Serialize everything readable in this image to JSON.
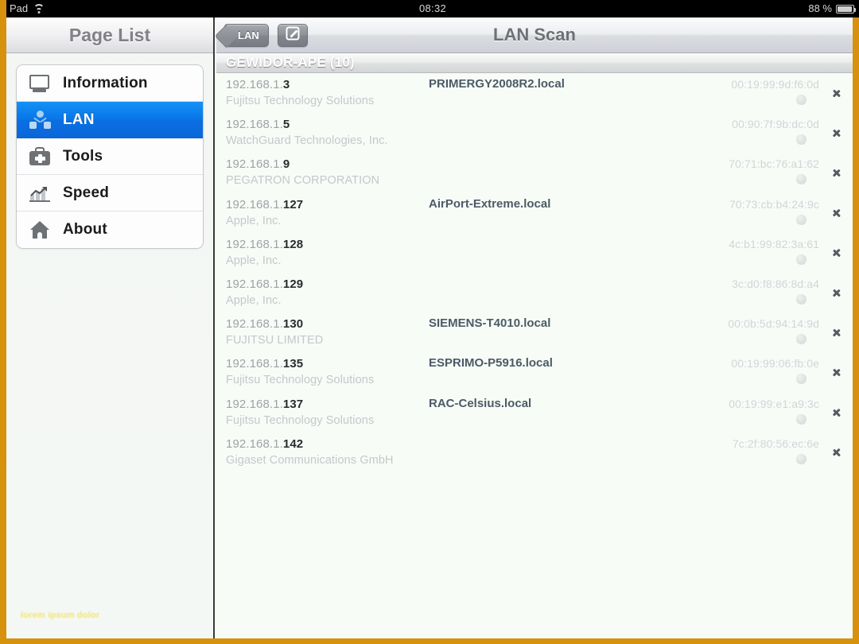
{
  "status_bar": {
    "carrier": "Pad",
    "wifi_icon": "wifi-icon",
    "time": "08:32",
    "battery_percent": "88 %",
    "battery_icon": "battery-icon"
  },
  "sidebar": {
    "title": "Page List",
    "items": [
      {
        "label": "Information",
        "icon": "monitor-icon",
        "selected": false
      },
      {
        "label": "LAN",
        "icon": "network-icon",
        "selected": true
      },
      {
        "label": "Tools",
        "icon": "toolkit-icon",
        "selected": false
      },
      {
        "label": "Speed",
        "icon": "bar-chart-icon",
        "selected": false
      },
      {
        "label": "About",
        "icon": "home-icon",
        "selected": false
      }
    ],
    "watermark": "lorem ipsum dolor"
  },
  "navbar": {
    "back_label": "LAN",
    "back_icon": "chevron-left-icon",
    "compose_icon": "compose-icon",
    "title": "LAN Scan"
  },
  "section": {
    "title": "GEWIDOR-APE (10)"
  },
  "colors": {
    "frame_orange": "#d6910d",
    "selection_blue": "#0a76e8",
    "hostname_blue": "#4d5a66",
    "background": "#f7fcf7"
  },
  "devices": [
    {
      "ip_prefix": "192.168.1.",
      "ip_last": "3",
      "vendor": "Fujitsu Technology Solutions",
      "hostname": "PRIMERGY2008R2.local",
      "mac": "00:19:99:9d:f6:0d"
    },
    {
      "ip_prefix": "192.168.1.",
      "ip_last": "5",
      "vendor": "WatchGuard Technologies, Inc.",
      "hostname": "",
      "mac": "00:90:7f:9b:dc:0d"
    },
    {
      "ip_prefix": "192.168.1.",
      "ip_last": "9",
      "vendor": "PEGATRON CORPORATION",
      "hostname": "",
      "mac": "70:71:bc:76:a1:62"
    },
    {
      "ip_prefix": "192.168.1.",
      "ip_last": "127",
      "vendor": "Apple, Inc.",
      "hostname": "AirPort-Extreme.local",
      "mac": "70:73:cb:b4:24:9c"
    },
    {
      "ip_prefix": "192.168.1.",
      "ip_last": "128",
      "vendor": "Apple, Inc.",
      "hostname": "",
      "mac": "4c:b1:99:82:3a:61"
    },
    {
      "ip_prefix": "192.168.1.",
      "ip_last": "129",
      "vendor": "Apple, Inc.",
      "hostname": "",
      "mac": "3c:d0:f8:86:8d:a4"
    },
    {
      "ip_prefix": "192.168.1.",
      "ip_last": "130",
      "vendor": "FUJITSU LIMITED",
      "hostname": "SIEMENS-T4010.local",
      "mac": "00:0b:5d:94:14:9d"
    },
    {
      "ip_prefix": "192.168.1.",
      "ip_last": "135",
      "vendor": "Fujitsu Technology Solutions",
      "hostname": "ESPRIMO-P5916.local",
      "mac": "00:19:99:06:fb:0e"
    },
    {
      "ip_prefix": "192.168.1.",
      "ip_last": "137",
      "vendor": "Fujitsu Technology Solutions",
      "hostname": "RAC-Celsius.local",
      "mac": "00:19:99:e1:a9:3c"
    },
    {
      "ip_prefix": "192.168.1.",
      "ip_last": "142",
      "vendor": "Gigaset Communications GmbH",
      "hostname": "",
      "mac": "7c:2f:80:56:ec:6e"
    }
  ]
}
